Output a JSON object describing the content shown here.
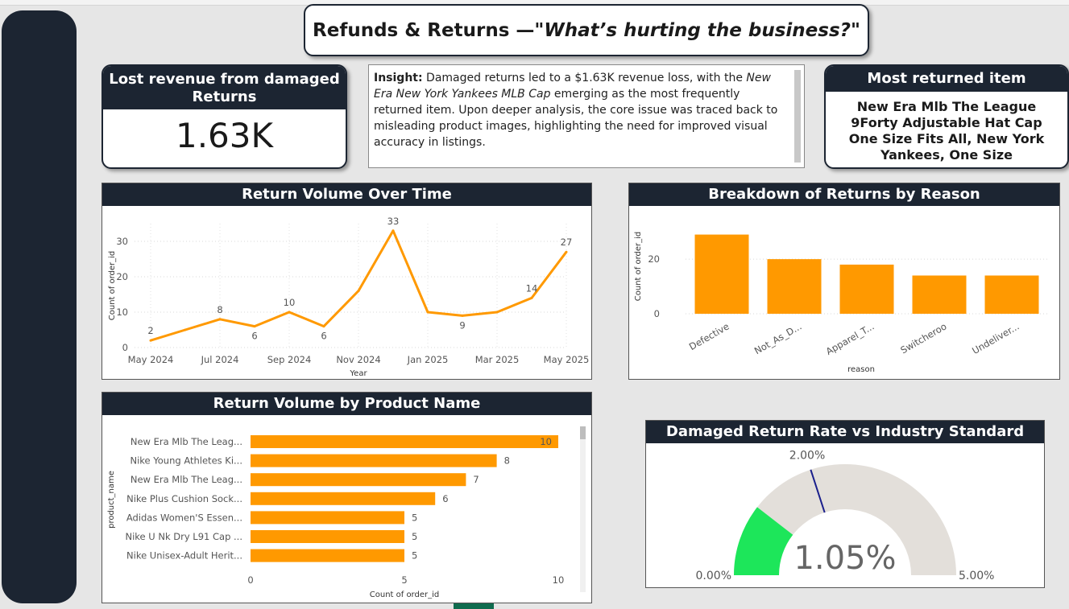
{
  "page": {
    "title_prefix": "Refunds & Returns — ",
    "title_emphasis": "\"What’s hurting the business?\""
  },
  "kpi_lost": {
    "label": "Lost revenue from damaged Returns",
    "value": "1.63K"
  },
  "insight": {
    "label": "Insight:",
    "text_before": " Damaged returns led to a $1.63K revenue loss, with the ",
    "emphasis": "New Era New York Yankees MLB Cap",
    "text_after": " emerging as the most frequently returned item. Upon deeper analysis, the core issue was traced back to misleading product images, highlighting the need for improved visual accuracy in listings."
  },
  "most_returned": {
    "label": "Most returned item",
    "value": "New Era Mlb The League 9Forty Adjustable Hat Cap One Size Fits All, New York Yankees, One Size"
  },
  "colors": {
    "accent": "#ff9900",
    "header": "#1c2532",
    "gauge_fill": "#1de65a",
    "gauge_track": "#e3dfda",
    "gauge_target": "#1a1f8c"
  },
  "chart_data": [
    {
      "type": "line",
      "title": "Return Volume Over Time",
      "xlabel": "Year",
      "ylabel": "Count of order_id",
      "x": [
        "2024-05",
        "2024-06",
        "2024-07",
        "2024-08",
        "2024-09",
        "2024-10",
        "2024-11",
        "2024-12",
        "2025-01",
        "2025-02",
        "2025-03",
        "2025-04",
        "2025-05"
      ],
      "values": [
        2,
        5,
        8,
        6,
        10,
        6,
        16,
        33,
        10,
        9,
        10,
        14,
        27
      ],
      "labeled_points": [
        0,
        2,
        3,
        4,
        5,
        7,
        9,
        11,
        12
      ],
      "x_ticks": [
        "May 2024",
        "Jul 2024",
        "Sep 2024",
        "Nov 2024",
        "Jan 2025",
        "Mar 2025",
        "May 2025"
      ],
      "y_ticks": [
        0,
        10,
        20,
        30
      ],
      "ylim": [
        0,
        35
      ],
      "grid": true
    },
    {
      "type": "bar",
      "title": "Breakdown of Returns by Reason",
      "xlabel": "reason",
      "ylabel": "Count of order_id",
      "categories": [
        "Defective",
        "Not_As_D...",
        "Apparel_T...",
        "Switcheroo",
        "Undeliver..."
      ],
      "values": [
        29,
        20,
        18,
        14,
        14
      ],
      "y_ticks": [
        0,
        20
      ],
      "ylim": [
        0,
        33
      ],
      "grid": true
    },
    {
      "type": "bar",
      "orientation": "horizontal",
      "title": "Return Volume by Product Name",
      "xlabel": "Count of order_id",
      "ylabel": "product_name",
      "categories": [
        "New Era Mlb The Leag...",
        "Nike Young Athletes Ki...",
        "New Era Mlb The Leag...",
        "Nike Plus Cushion Sock...",
        "Adidas Women'S Essen...",
        "Nike U Nk Dry L91 Cap ...",
        "Nike Unisex-Adult Herit..."
      ],
      "values": [
        10,
        8,
        7,
        6,
        5,
        5,
        5
      ],
      "x_ticks": [
        0,
        5,
        10
      ],
      "xlim": [
        0,
        10
      ]
    },
    {
      "type": "gauge",
      "title": "Damaged Return Rate vs Industry Standard",
      "value": 1.05,
      "value_label": "1.05%",
      "min": 0,
      "max": 5,
      "target": 2,
      "min_label": "0.00%",
      "max_label": "5.00%",
      "target_label": "2.00%"
    }
  ]
}
